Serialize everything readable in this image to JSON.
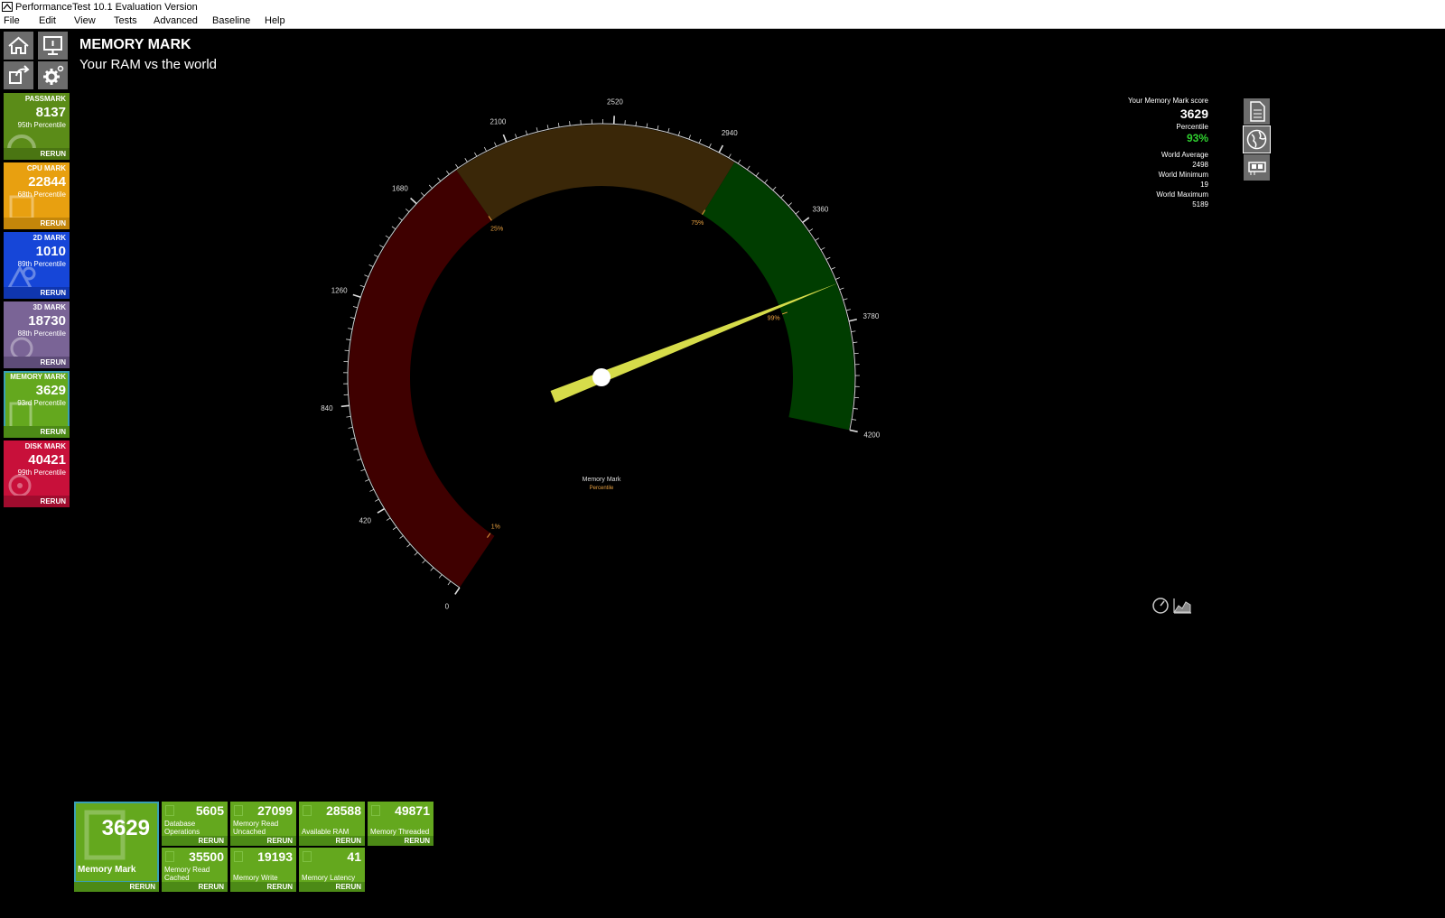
{
  "window": {
    "title": "PerformanceTest 10.1 Evaluation Version"
  },
  "menu": [
    "File",
    "Edit",
    "View",
    "Tests",
    "Advanced",
    "Baseline",
    "Help"
  ],
  "page": {
    "heading": "MEMORY MARK",
    "subheading": "Your RAM vs the world"
  },
  "toolbar_icons": [
    "home-icon",
    "monitor-icon",
    "upload-icon",
    "gear-icon"
  ],
  "tiles": [
    {
      "label": "PASSMARK",
      "value": "8137",
      "percentile": "95th Percentile",
      "rerun": "RERUN",
      "color": "#5b8c18",
      "bar": "#4a7512"
    },
    {
      "label": "CPU MARK",
      "value": "22844",
      "percentile": "68th Percentile",
      "rerun": "RERUN",
      "color": "#e8a010",
      "bar": "#c4860a"
    },
    {
      "label": "2D MARK",
      "value": "1010",
      "percentile": "89th Percentile",
      "rerun": "RERUN",
      "color": "#1646d8",
      "bar": "#0f36b0"
    },
    {
      "label": "3D MARK",
      "value": "18730",
      "percentile": "88th Percentile",
      "rerun": "RERUN",
      "color": "#7a6496",
      "bar": "#5e4c78"
    },
    {
      "label": "MEMORY MARK",
      "value": "3629",
      "percentile": "93rd Percentile",
      "rerun": "RERUN",
      "color": "#64a81e",
      "bar": "#4c8a16"
    },
    {
      "label": "DISK MARK",
      "value": "40421",
      "percentile": "99th Percentile",
      "rerun": "RERUN",
      "color": "#c8103a",
      "bar": "#a00c2e"
    }
  ],
  "gauge": {
    "min": 0,
    "max": 4200,
    "value": 3629,
    "tick_labels": [
      "0",
      "420",
      "840",
      "1260",
      "1680",
      "2100",
      "2520",
      "2940",
      "3360",
      "3780",
      "4200"
    ],
    "percentile_marks": [
      {
        "label": "1%",
        "value": 25
      },
      {
        "label": "25%",
        "value": 1880
      },
      {
        "label": "75%",
        "value": 3010
      },
      {
        "label": "99%",
        "value": 3670
      }
    ],
    "bands": [
      {
        "from": 0,
        "to": 1880,
        "color": "#3f0000"
      },
      {
        "from": 1880,
        "to": 3010,
        "color": "#3a2708"
      },
      {
        "from": 3010,
        "to": 4200,
        "color": "#003d00"
      }
    ],
    "center_label": "Memory Mark",
    "center_sublabel": "Percentile",
    "needle_color": "#d6dc4a"
  },
  "stats": {
    "score_label": "Your Memory Mark score",
    "score": "3629",
    "percentile_label": "Percentile",
    "percentile": "93%",
    "world_average_label": "World Average",
    "world_average": "2498",
    "world_minimum_label": "World Minimum",
    "world_minimum": "19",
    "world_maximum_label": "World Maximum",
    "world_maximum": "5189"
  },
  "side_icons": [
    "document-icon",
    "globe-icon",
    "memory-chip-icon"
  ],
  "view_icons": [
    "gauge-view-icon",
    "chart-view-icon"
  ],
  "summary": {
    "big": {
      "value": "3629",
      "name": "Memory Mark",
      "rerun": "RERUN"
    },
    "subtests": [
      {
        "value": "5605",
        "name": "Database Operations",
        "rerun": "RERUN"
      },
      {
        "value": "27099",
        "name": "Memory Read Uncached",
        "rerun": "RERUN"
      },
      {
        "value": "28588",
        "name": "Available RAM",
        "rerun": "RERUN"
      },
      {
        "value": "49871",
        "name": "Memory Threaded",
        "rerun": "RERUN"
      },
      {
        "value": "35500",
        "name": "Memory Read Cached",
        "rerun": "RERUN"
      },
      {
        "value": "19193",
        "name": "Memory Write",
        "rerun": "RERUN"
      },
      {
        "value": "41",
        "name": "Memory Latency",
        "rerun": "RERUN"
      }
    ]
  }
}
